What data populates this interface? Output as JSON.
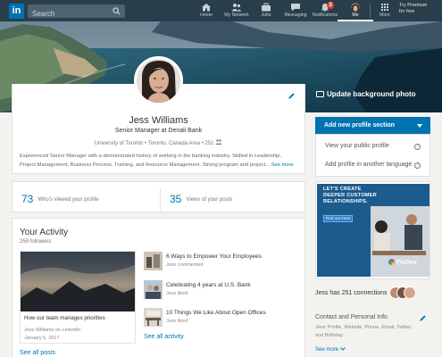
{
  "nav": {
    "logo": "in",
    "search_placeholder": "Search",
    "items": [
      {
        "label": "Home",
        "icon": "home-icon"
      },
      {
        "label": "My Network",
        "icon": "network-icon"
      },
      {
        "label": "Jobs",
        "icon": "briefcase-icon"
      },
      {
        "label": "Messaging",
        "icon": "messaging-icon"
      },
      {
        "label": "Notifications",
        "icon": "bell-icon",
        "badge": "3"
      },
      {
        "label": "Me",
        "icon": "avatar-icon",
        "active": true
      },
      {
        "label": "More",
        "icon": "grid-icon"
      }
    ],
    "premium_line1": "Try Premium",
    "premium_line2": "for free"
  },
  "banner": {
    "update_label": "Update background photo"
  },
  "profile": {
    "name": "Jess Williams",
    "headline": "Senior Manager at Denali Bank",
    "location": "University of Toronto • Toronto, Canada Area • 251",
    "summary": "Experienced Senior Manager with a demonstrated history of working in the banking industry. Skilled in Leadership, Project Management, Business Process, Training, and Resource Management. Strong program and project...",
    "see_more": "See more"
  },
  "stats": {
    "viewed_count": "73",
    "viewed_label": "Who's viewed your profile",
    "views_count": "35",
    "views_label": "Views of your posts"
  },
  "activity": {
    "title": "Your Activity",
    "followers": "259 followers",
    "post": {
      "title": "How our team manages priorities",
      "source": "Jess Williams on LinkedIn",
      "date": "January 5, 2017"
    },
    "see_posts": "See all posts",
    "items": [
      {
        "title": "6 Ways to Empower Your Employees",
        "sub": "Jess commented"
      },
      {
        "title": "Celebrating 4 years at U.S. Bank",
        "sub": "Jess liked"
      },
      {
        "title": "10 Things We Like About Open Offices",
        "sub": "Jess liked"
      }
    ],
    "see_activity": "See all activity"
  },
  "rightrail": {
    "add_section": "Add new profile section",
    "public_profile": "View your public profile",
    "another_language": "Add profile in another language",
    "ad": {
      "headline_1": "LET'S CREATE",
      "headline_2": "DEEPER CUSTOMER",
      "headline_3": "RELATIONSHIPS.",
      "cta": "Find out more",
      "brand": "FixDex"
    },
    "connections": "Jess has 251 connections",
    "contact_title": "Contact and Personal Info",
    "contact_sub": "Jess' Profile, Website, Phone, Email, Twitter, and Birthday",
    "see_more": "See more"
  }
}
